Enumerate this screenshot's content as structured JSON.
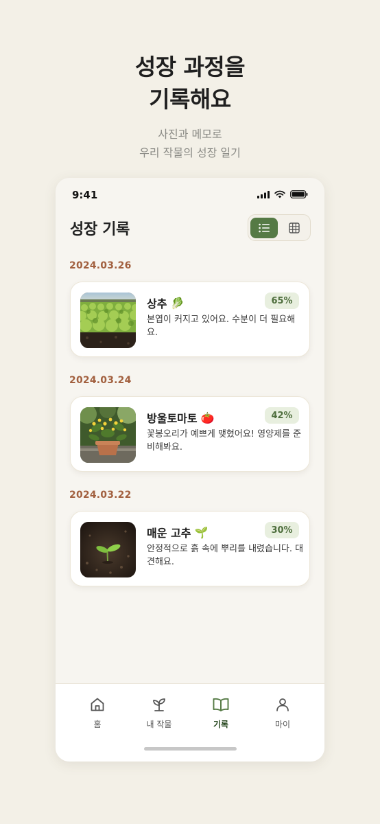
{
  "hero": {
    "title_line1": "성장 과정을",
    "title_line2": "기록해요",
    "subtitle_line1": "사진과 메모로",
    "subtitle_line2": "우리 작물의 성장 일기"
  },
  "status_bar": {
    "time": "9:41"
  },
  "screen": {
    "title": "성장 기록"
  },
  "view_toggle": {
    "selected": "list"
  },
  "records": [
    {
      "date": "2024.03.26",
      "crop": "상추",
      "emoji": "🥬",
      "progress": "65%",
      "note": "본엽이 커지고 있어요. 수분이 더 필요해요.",
      "thumbnail": "lettuce-field-photo"
    },
    {
      "date": "2024.03.24",
      "crop": "방울토마토",
      "emoji": "🍅",
      "progress": "42%",
      "note": "꽃봉오리가 예쁘게 맺혔어요! 영양제를 준비해봐요.",
      "thumbnail": "tomato-plant-flowers-photo"
    },
    {
      "date": "2024.03.22",
      "crop": "매운 고추",
      "emoji": "🌱",
      "progress": "30%",
      "note": "안정적으로 흙 속에 뿌리를 내렸습니다. 대견해요.",
      "thumbnail": "seedling-in-soil-photo"
    }
  ],
  "tab_bar": {
    "items": [
      {
        "label": "홈",
        "icon": "home-icon"
      },
      {
        "label": "내 작물",
        "icon": "sprout-icon"
      },
      {
        "label": "기록",
        "icon": "book-icon",
        "active": true
      },
      {
        "label": "마이",
        "icon": "person-icon"
      }
    ]
  },
  "colors": {
    "accent": "#557a45",
    "date": "#a2603f",
    "badge_bg": "#e8efdf",
    "background": "#f3f0e7"
  }
}
